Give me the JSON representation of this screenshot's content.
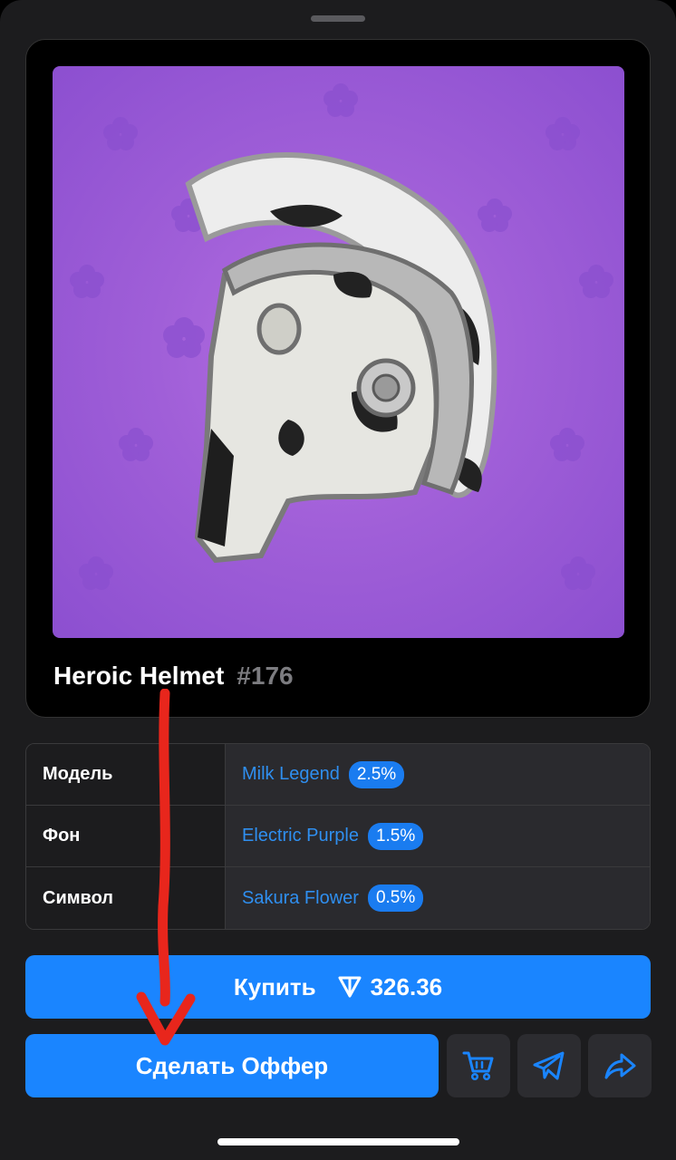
{
  "gift": {
    "title": "Heroic Helmet",
    "number": "#176",
    "image_icon": "spartan-helmet-cow-pattern",
    "background_color": "#a463dc"
  },
  "attributes": [
    {
      "key": "Модель",
      "value": "Milk Legend",
      "rarity": "2.5%"
    },
    {
      "key": "Фон",
      "value": "Electric Purple",
      "rarity": "1.5%"
    },
    {
      "key": "Символ",
      "value": "Sakura Flower",
      "rarity": "0.5%"
    }
  ],
  "actions": {
    "buy_label": "Купить",
    "price": "326.36",
    "price_icon": "ton-icon",
    "offer_label": "Сделать Оффер",
    "cart_icon": "cart-icon",
    "send_icon": "telegram-send-icon",
    "share_icon": "share-icon"
  },
  "colors": {
    "accent": "#1a85ff",
    "link": "#2f8ff0",
    "annotation_arrow": "#e8261c"
  }
}
